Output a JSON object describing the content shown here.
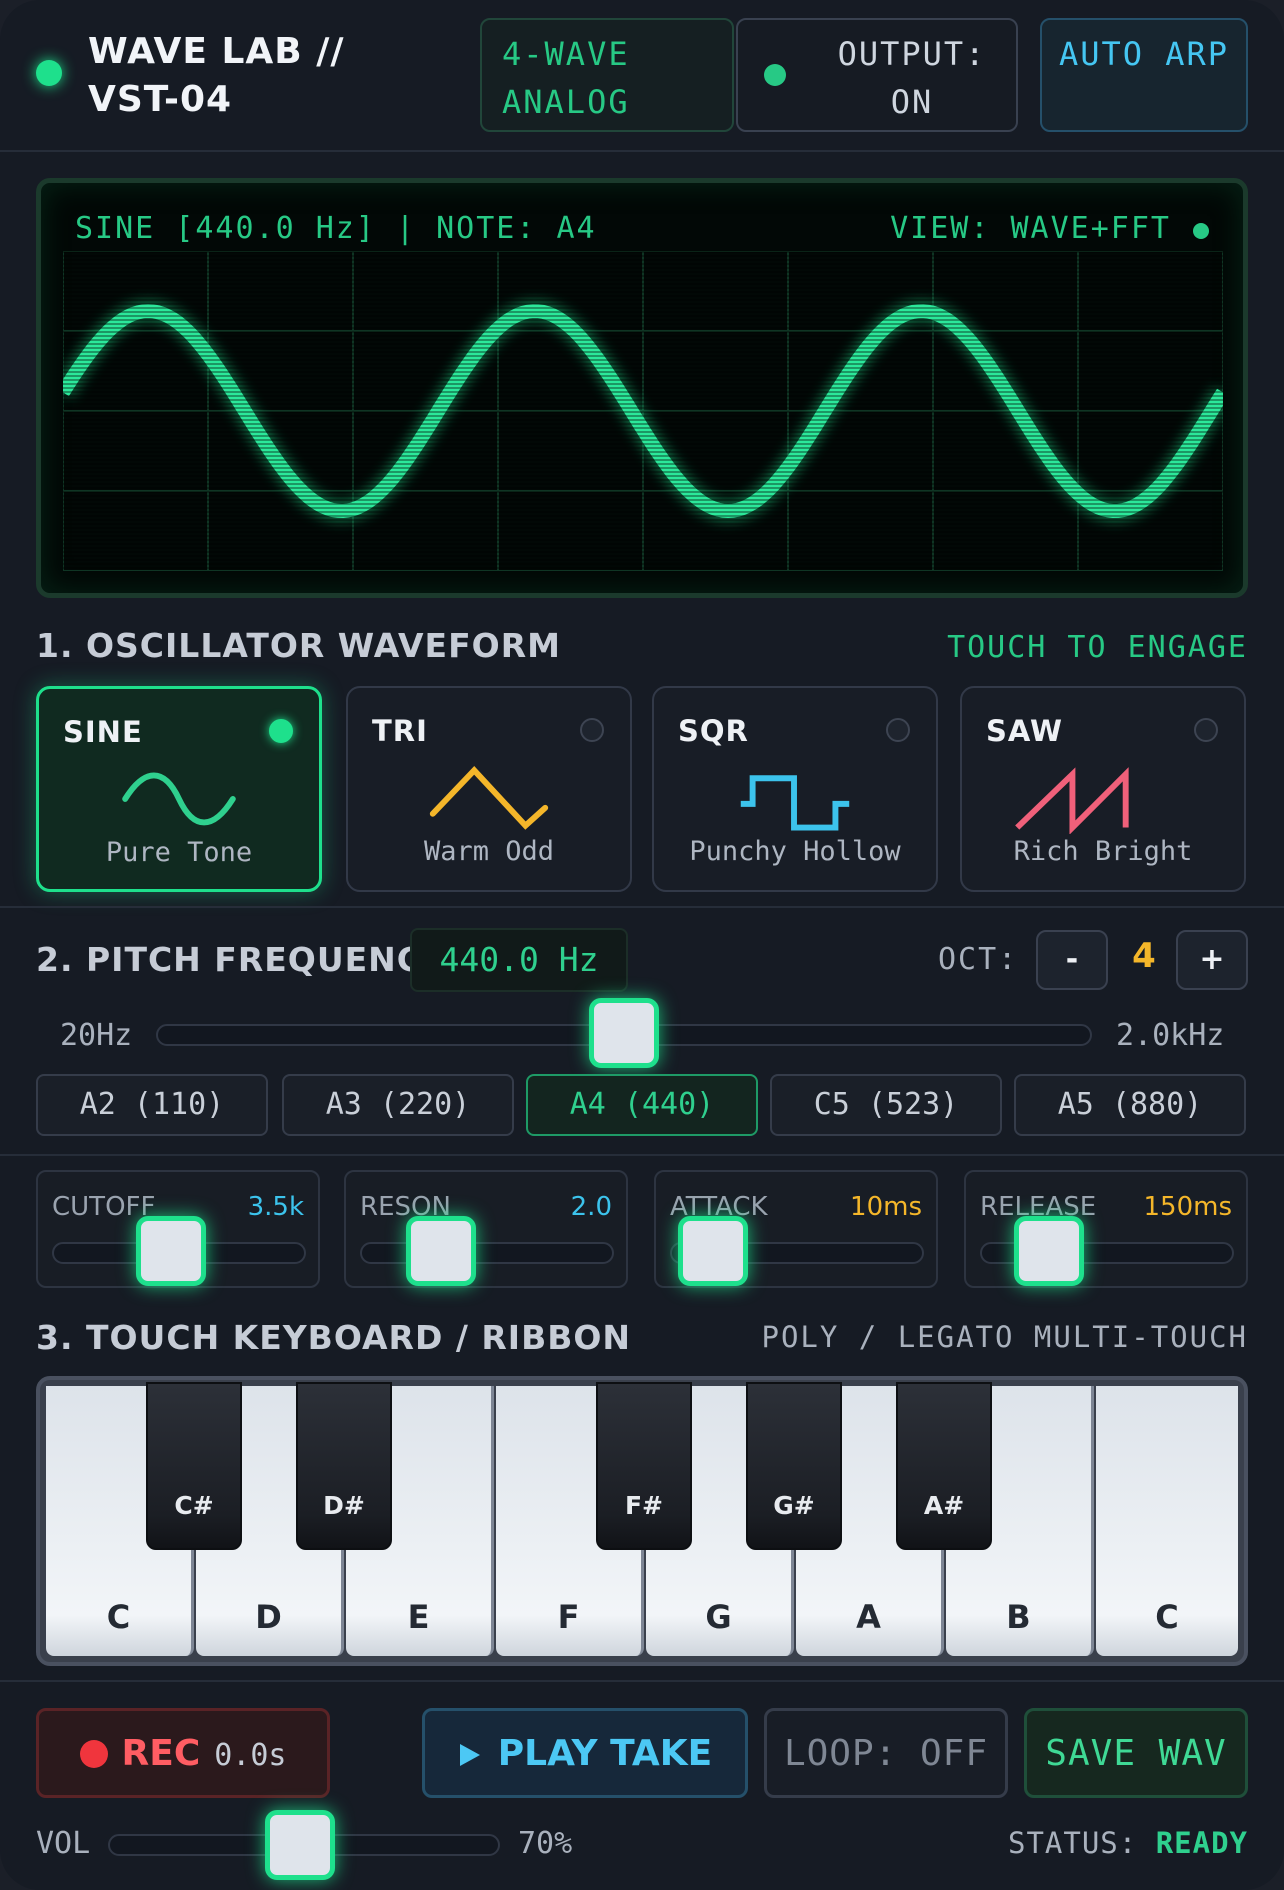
{
  "header": {
    "title": "WAVE LAB // VST-04",
    "engine": "4-WAVE ANALOG",
    "output": "OUTPUT: ON",
    "arp": "AUTO ARP"
  },
  "scope": {
    "left_text": "SINE [440.0 Hz] | NOTE: A4",
    "right_text": "VIEW: WAVE+FFT"
  },
  "oscillator": {
    "title": "1. OSCILLATOR WAVEFORM",
    "hint": "TOUCH TO ENGAGE",
    "waves": [
      {
        "name": "SINE",
        "sub": "Pure Tone",
        "active": true,
        "color": "#2fd08e"
      },
      {
        "name": "TRI",
        "sub": "Warm Odd",
        "active": false,
        "color": "#f4b62a"
      },
      {
        "name": "SQR",
        "sub": "Punchy Hollow",
        "active": false,
        "color": "#3cc3ec"
      },
      {
        "name": "SAW",
        "sub": "Rich Bright",
        "active": false,
        "color": "#f0607a"
      }
    ]
  },
  "pitch": {
    "title": "2. PITCH FREQUENCY",
    "value": "440.0 Hz",
    "oct_label": "OCT:",
    "oct_minus": "-",
    "oct_value": "4",
    "oct_plus": "+",
    "min": "20Hz",
    "max": "2.0kHz",
    "slider_fraction": 0.5,
    "notes": [
      {
        "label": "A2 (110)",
        "active": false
      },
      {
        "label": "A3 (220)",
        "active": false
      },
      {
        "label": "A4 (440)",
        "active": true
      },
      {
        "label": "C5 (523)",
        "active": false
      },
      {
        "label": "A5 (880)",
        "active": false
      }
    ]
  },
  "params": [
    {
      "name": "CUTOFF",
      "value": "3.5k",
      "fraction": 0.35,
      "color": "#3cc3ec"
    },
    {
      "name": "RESON",
      "value": "2.0",
      "fraction": 0.2,
      "color": "#3cc3ec"
    },
    {
      "name": "ATTACK",
      "value": "10ms",
      "fraction": 0.05,
      "color": "#f4b62a"
    },
    {
      "name": "RELEASE",
      "value": "150ms",
      "fraction": 0.15,
      "color": "#f4b62a"
    }
  ],
  "keyboard": {
    "title": "3. TOUCH KEYBOARD / RIBBON",
    "mode": "POLY / LEGATO MULTI-TOUCH",
    "white_keys": [
      "C",
      "D",
      "E",
      "F",
      "G",
      "A",
      "B",
      "C"
    ],
    "black_keys": [
      "C#",
      "D#",
      "F#",
      "G#",
      "A#"
    ]
  },
  "transport": {
    "rec": "REC",
    "rec_time": "0.0s",
    "play": "PLAY TAKE",
    "loop": "LOOP: OFF",
    "save": "SAVE WAV",
    "vol_label": "VOL",
    "vol_value": "70%",
    "vol_fraction": 0.7,
    "status_label": "STATUS:",
    "status_value": "READY"
  },
  "colors": {
    "accent": "#1ee08c",
    "amber": "#f4b62a",
    "cyan": "#3cc3ec",
    "rec": "#ff5d63"
  }
}
